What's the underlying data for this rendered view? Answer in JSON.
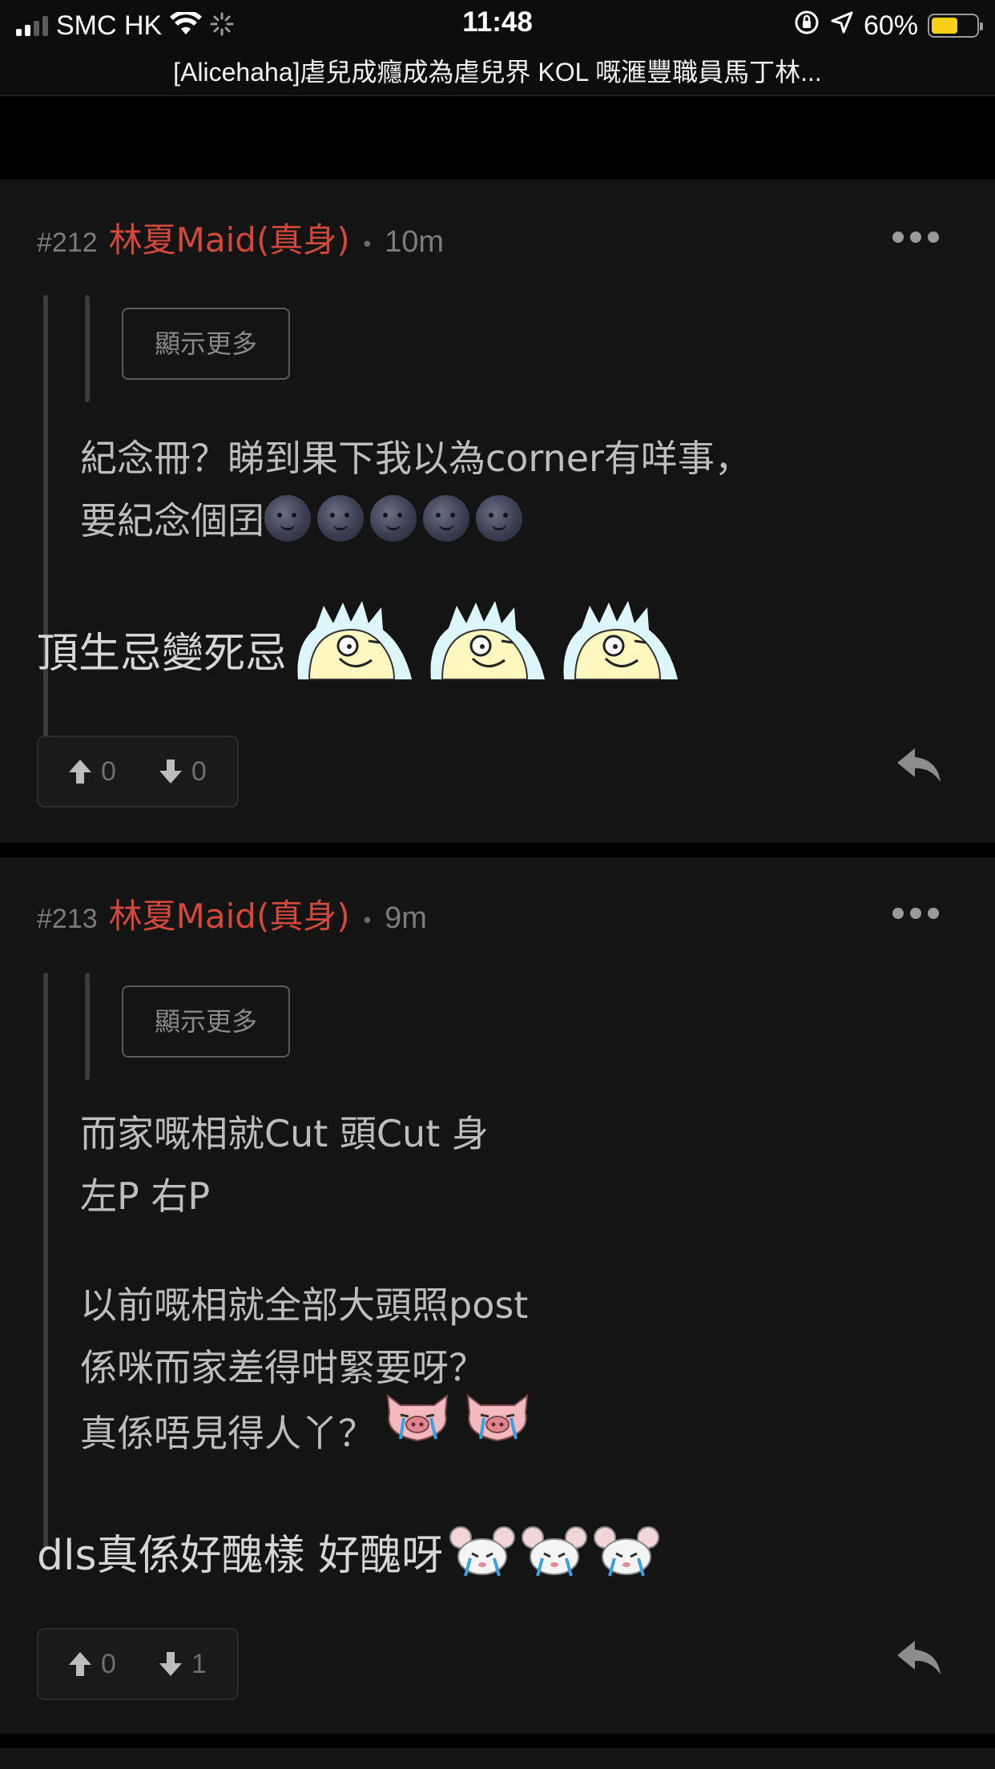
{
  "status_bar": {
    "carrier": "SMC HK",
    "time": "11:48",
    "battery": "60%",
    "battery_level": 0.6,
    "battery_color": "#f7d117"
  },
  "thread": {
    "title": "[Alicehaha]虐兒成癮成為虐兒界 KOL 嘅滙豐職員馬丁林..."
  },
  "colors": {
    "author": "#d2493c",
    "background": "#141414",
    "separator": "#000000"
  },
  "posts": [
    {
      "floor": "#212",
      "author": "林夏Maid(真身)",
      "separator": "•",
      "time": "10m",
      "show_more": "顯示更多",
      "quote_lines": [
        "紀念冊？睇到果下我以為corner有咩事，",
        "要紀念個囝"
      ],
      "quote_emoji": "moon-face",
      "text": "頂生忌變死忌",
      "sticker": "shocked-ghost-sticker",
      "upvotes": "0",
      "downvotes": "0"
    },
    {
      "floor": "#213",
      "author": "林夏Maid(真身)",
      "separator": "•",
      "time": "9m",
      "show_more": "顯示更多",
      "quote_lines": [
        "而家嘅相就Cut 頭Cut 身",
        "左P 右P",
        "以前嘅相就全部大頭照post",
        "係咪而家差得咁緊要呀？",
        "真係唔見得人丫？"
      ],
      "quote_sticker": "crying-pig-sticker",
      "text": "dls真係好醜樣 好醜呀",
      "sticker": "crying-mouse-sticker",
      "upvotes": "0",
      "downvotes": "1"
    }
  ]
}
